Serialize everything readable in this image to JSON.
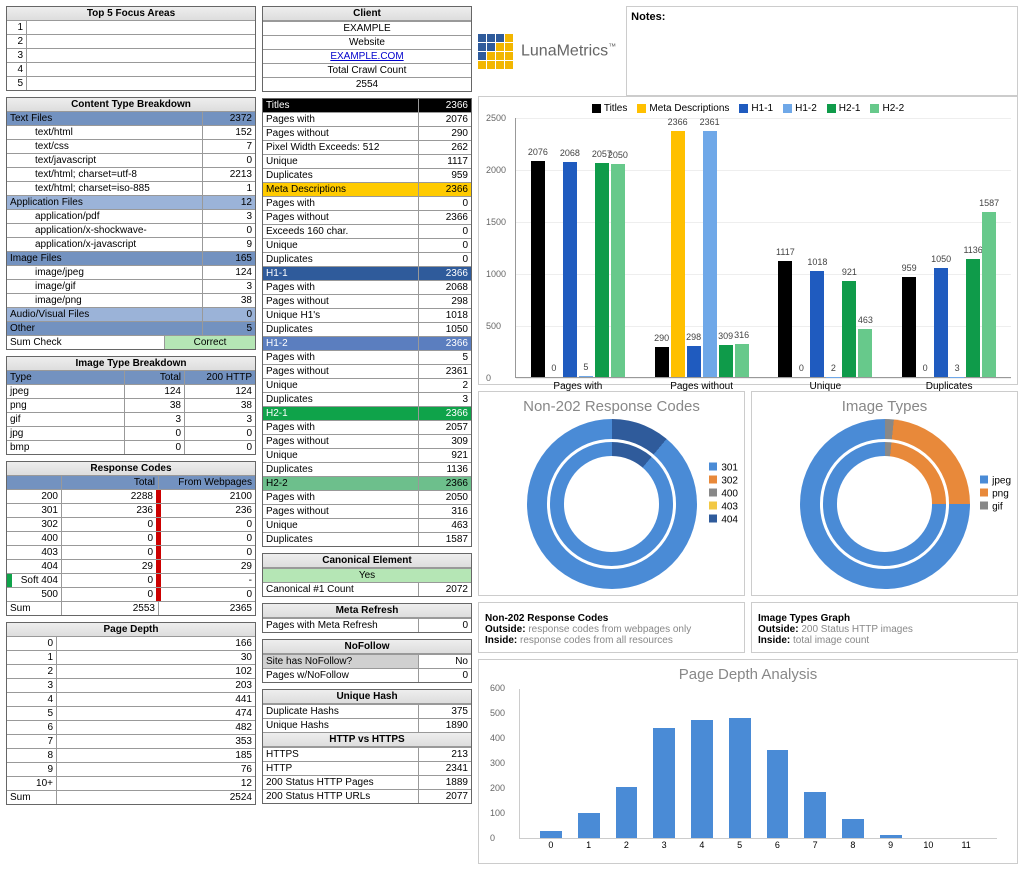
{
  "focus": {
    "header": "Top 5 Focus Areas",
    "rows": [
      "1",
      "2",
      "3",
      "4",
      "5"
    ]
  },
  "client": {
    "header": "Client",
    "name": "EXAMPLE",
    "website_label": "Website",
    "website": "EXAMPLE.COM",
    "crawl_label": "Total Crawl Count",
    "crawl": "2554"
  },
  "content": {
    "header": "Content Type Breakdown",
    "text_files": {
      "label": "Text Files",
      "val": "2372",
      "items": [
        {
          "l": "text/html",
          "v": "152"
        },
        {
          "l": "text/css",
          "v": "7"
        },
        {
          "l": "text/javascript",
          "v": "0"
        },
        {
          "l": "text/html; charset=utf-8",
          "v": "2213"
        },
        {
          "l": "text/html; charset=iso-885",
          "v": "1"
        }
      ]
    },
    "app_files": {
      "label": "Application Files",
      "val": "12",
      "items": [
        {
          "l": "application/pdf",
          "v": "3"
        },
        {
          "l": "application/x-shockwave-",
          "v": "0"
        },
        {
          "l": "application/x-javascript",
          "v": "9"
        }
      ]
    },
    "image_files": {
      "label": "Image Files",
      "val": "165",
      "items": [
        {
          "l": "image/jpeg",
          "v": "124"
        },
        {
          "l": "image/gif",
          "v": "3"
        },
        {
          "l": "image/png",
          "v": "38"
        }
      ]
    },
    "audio": {
      "label": "Audio/Visual Files",
      "val": "0"
    },
    "other": {
      "label": "Other",
      "val": "5"
    },
    "sumcheck": {
      "label": "Sum Check",
      "val": "Correct"
    }
  },
  "imgtype": {
    "header": "Image Type Breakdown",
    "cols": [
      "Type",
      "Total",
      "200 HTTP"
    ],
    "rows": [
      [
        "jpeg",
        "124",
        "124"
      ],
      [
        "png",
        "38",
        "38"
      ],
      [
        "gif",
        "3",
        "3"
      ],
      [
        "jpg",
        "0",
        "0"
      ],
      [
        "bmp",
        "0",
        "0"
      ]
    ]
  },
  "resp": {
    "header": "Response Codes",
    "cols": [
      "",
      "Total",
      "From Webpages"
    ],
    "rows": [
      [
        "200",
        "2288",
        "2100"
      ],
      [
        "301",
        "236",
        "236"
      ],
      [
        "302",
        "0",
        "0"
      ],
      [
        "400",
        "0",
        "0"
      ],
      [
        "403",
        "0",
        "0"
      ],
      [
        "404",
        "29",
        "29"
      ],
      [
        "Soft 404",
        "0",
        "-"
      ],
      [
        "500",
        "0",
        "0"
      ]
    ],
    "sum": [
      "Sum",
      "2553",
      "2365"
    ]
  },
  "depth": {
    "header": "Page Depth",
    "rows": [
      [
        "0",
        "166"
      ],
      [
        "1",
        "30"
      ],
      [
        "2",
        "102"
      ],
      [
        "3",
        "203"
      ],
      [
        "4",
        "441"
      ],
      [
        "5",
        "474"
      ],
      [
        "6",
        "482"
      ],
      [
        "7",
        "353"
      ],
      [
        "8",
        "185"
      ],
      [
        "9",
        "76"
      ],
      [
        "10+",
        "12"
      ]
    ],
    "sum": [
      "Sum",
      "2524"
    ]
  },
  "sections": [
    {
      "title": "Titles",
      "cls": "bg-black",
      "val": "2366",
      "rows": [
        [
          "Pages with",
          "2076"
        ],
        [
          "Pages without",
          "290"
        ],
        [
          "Pixel Width Exceeds:   512",
          "262"
        ],
        [
          "Unique",
          "1117"
        ],
        [
          "Duplicates",
          "959"
        ]
      ]
    },
    {
      "title": "Meta Descriptions",
      "cls": "bg-yellow",
      "val": "2366",
      "rows": [
        [
          "Pages with",
          "0"
        ],
        [
          "Pages without",
          "2366"
        ],
        [
          "Exceeds 160 char.",
          "0"
        ],
        [
          "Unique",
          "0"
        ],
        [
          "Duplicates",
          "0"
        ]
      ]
    },
    {
      "title": "H1-1",
      "cls": "bg-darkblue",
      "val": "2366",
      "rows": [
        [
          "Pages with",
          "2068"
        ],
        [
          "Pages without",
          "298"
        ],
        [
          "Unique H1's",
          "1018"
        ],
        [
          "Duplicates",
          "1050"
        ]
      ]
    },
    {
      "title": "H1-2",
      "cls": "bg-mediumblue",
      "val": "2366",
      "rows": [
        [
          "Pages with",
          "5"
        ],
        [
          "Pages without",
          "2361"
        ],
        [
          "Unique",
          "2"
        ],
        [
          "Duplicates",
          "3"
        ]
      ]
    },
    {
      "title": "H2-1",
      "cls": "bg-green",
      "val": "2366",
      "rows": [
        [
          "Pages with",
          "2057"
        ],
        [
          "Pages without",
          "309"
        ],
        [
          "Unique",
          "921"
        ],
        [
          "Duplicates",
          "1136"
        ]
      ]
    },
    {
      "title": "H2-2",
      "cls": "bg-green2",
      "val": "2366",
      "rows": [
        [
          "Pages with",
          "2050"
        ],
        [
          "Pages without",
          "316"
        ],
        [
          "Unique",
          "463"
        ],
        [
          "Duplicates",
          "1587"
        ]
      ]
    }
  ],
  "canonical": {
    "header": "Canonical Element",
    "yes": "Yes",
    "label": "Canonical #1 Count",
    "val": "2072"
  },
  "metarefresh": {
    "header": "Meta Refresh",
    "label": "Pages with Meta Refresh",
    "val": "0"
  },
  "nofollow": {
    "header": "NoFollow",
    "site_label": "Site has NoFollow?",
    "site_val": "No",
    "pages_label": "Pages w/NoFollow",
    "pages_val": "0"
  },
  "uhash": {
    "header": "Unique Hash",
    "dup_label": "Duplicate Hashs",
    "dup_val": "375",
    "uni_label": "Unique Hashs",
    "uni_val": "1890",
    "https_header": "HTTP vs HTTPS",
    "https_label": "HTTPS",
    "https_val": "213",
    "http_label": "HTTP",
    "http_val": "2341",
    "p200_label": "200 Status HTTP Pages",
    "p200_val": "1889",
    "u200_label": "200 Status HTTP URLs",
    "u200_val": "2077"
  },
  "notes_label": "Notes:",
  "logo": "LunaMetrics",
  "chart_data": {
    "bar": {
      "type": "bar",
      "categories": [
        "Pages with",
        "Pages without",
        "Unique",
        "Duplicates"
      ],
      "series": [
        {
          "name": "Titles",
          "color": "#000",
          "values": [
            2076,
            290,
            1117,
            959
          ]
        },
        {
          "name": "Meta Descriptions",
          "color": "#ffc000",
          "values": [
            0,
            2366,
            0,
            0
          ]
        },
        {
          "name": "H1-1",
          "color": "#1f5bbf",
          "values": [
            2068,
            298,
            1018,
            1050
          ]
        },
        {
          "name": "H1-2",
          "color": "#6fa8e8",
          "values": [
            5,
            2361,
            2,
            3
          ]
        },
        {
          "name": "H2-1",
          "color": "#0f9b4a",
          "values": [
            2057,
            309,
            921,
            1136
          ]
        },
        {
          "name": "H2-2",
          "color": "#67c98b",
          "values": [
            2050,
            316,
            463,
            1587
          ]
        }
      ],
      "ymax": 2500
    },
    "donut_resp": {
      "title": "Non-202 Response Codes",
      "legend": [
        "301",
        "302",
        "400",
        "403",
        "404"
      ],
      "colors": [
        "#4a8bd6",
        "#e8893a",
        "#888888",
        "#f2c844",
        "#2f5b9b"
      ],
      "outside_label": "response codes from webpages only",
      "inside_label": "response codes from all resources",
      "caption": "Non-202 Response Codes"
    },
    "donut_img": {
      "title": "Image Types",
      "legend": [
        "jpeg",
        "png",
        "gif"
      ],
      "colors": [
        "#4a8bd6",
        "#e8893a",
        "#888888"
      ],
      "outside_label": "200 Status HTTP images",
      "inside_label": "total image count",
      "caption": "Image Types Graph"
    },
    "outside_word": "Outside:",
    "inside_word": "Inside:",
    "depth": {
      "title": "Page Depth Analysis",
      "type": "bar",
      "categories": [
        "0",
        "1",
        "2",
        "3",
        "4",
        "5",
        "6",
        "7",
        "8",
        "9",
        "10",
        "11"
      ],
      "values": [
        30,
        102,
        203,
        441,
        474,
        482,
        353,
        185,
        76,
        12,
        0,
        0
      ],
      "ymax": 600,
      "yticks": [
        0,
        100,
        200,
        300,
        400,
        500,
        600
      ]
    }
  }
}
